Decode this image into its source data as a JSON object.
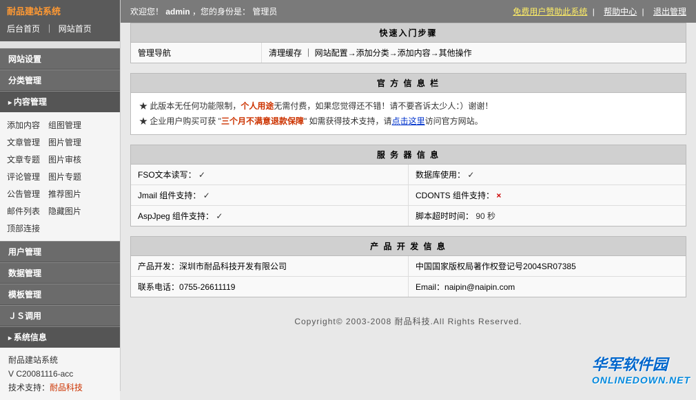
{
  "sidebar": {
    "title": "耐品建站系统",
    "topnav": {
      "backend": "后台首页",
      "frontend": "网站首页"
    },
    "siteSettings": "网站设置",
    "categoryMgmt": "分类管理",
    "contentMgmt": "内容管理",
    "contentSub": [
      {
        "l": "添加内容",
        "r": "组图管理"
      },
      {
        "l": "文章管理",
        "r": "图片管理"
      },
      {
        "l": "文章专题",
        "r": "图片审核"
      },
      {
        "l": "评论管理",
        "r": "图片专题"
      },
      {
        "l": "公告管理",
        "r": "推荐图片"
      },
      {
        "l": "邮件列表",
        "r": "隐藏图片"
      },
      {
        "l": "顶部连接",
        "r": ""
      }
    ],
    "userMgmt": "用户管理",
    "dataMgmt": "数据管理",
    "tplMgmt": "模板管理",
    "jsCall": "ＪＳ调用",
    "sysInfo": "系统信息",
    "sysInfoBody": {
      "line1": "耐品建站系统",
      "line2": "V C20081116-acc",
      "line3_label": "技术支持：",
      "line3_link": "耐品科技"
    }
  },
  "topbar": {
    "welcome_prefix": "欢迎您！",
    "username": "admin",
    "role_prefix": "，您的身份是：",
    "role": "管理员",
    "sponsor": "免费用户赞助此系统",
    "help": "帮助中心",
    "logout": "退出管理"
  },
  "quickstart": {
    "title": "快速入门步骤",
    "nav_label": "管理导航",
    "steps": "清理缓存 ｜ 网站配置→添加分类→添加内容→其他操作"
  },
  "official": {
    "title": "官 方 信 息 栏",
    "line1_a": "★ 此版本无任何功能限制，",
    "line1_b": "个人用途",
    "line1_c": "无需付费，如果您觉得还不错！请不要吝诉太少人：）谢谢！",
    "line2_a": "★ 企业用户购买可获 \"",
    "line2_b": "三个月不满意退款保障",
    "line2_c": "\" 如需获得技术支持，请",
    "line2_link": "点击这里",
    "line2_d": "访问官方网站。"
  },
  "server": {
    "title": "服 务 器 信 息",
    "rows": [
      {
        "l_label": "FSO文本读写：",
        "l_val": "✓",
        "l_ok": true,
        "r_label": "数据库使用：",
        "r_val": "✓",
        "r_ok": true
      },
      {
        "l_label": "Jmail 组件支持：",
        "l_val": "✓",
        "l_ok": true,
        "r_label": "CDONTS 组件支持：",
        "r_val": "×",
        "r_ok": false
      },
      {
        "l_label": "AspJpeg 组件支持：",
        "l_val": "✓",
        "l_ok": true,
        "r_label": "脚本超时时间：",
        "r_val": "90 秒",
        "r_ok": true
      }
    ]
  },
  "product": {
    "title": "产 品 开 发 信 息",
    "dev_label": "产品开发：",
    "dev_val": "深圳市耐品科技开发有限公司",
    "reg_label": "中国国家版权局著作权登记号",
    "reg_val": "2004SR07385",
    "tel_label": "联系电话：",
    "tel_val": "0755-26611119",
    "email_label": "Email：",
    "email_val": "naipin@naipin.com"
  },
  "footer": "Copyright© 2003-2008 耐品科技.All Rights Reserved.",
  "watermark": {
    "main": "华军软件园",
    "sub": "ONLINEDOWN.NET"
  }
}
